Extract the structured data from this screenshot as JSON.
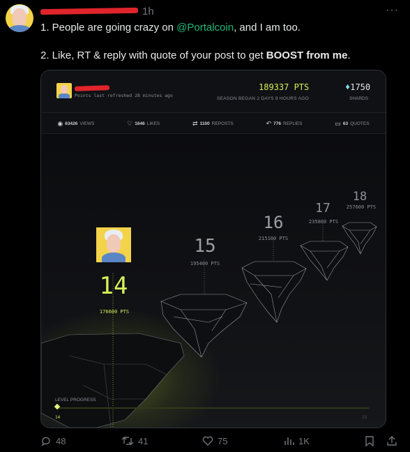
{
  "tweet": {
    "time": "1h",
    "more": "···",
    "line1_pre": "1. People are going crazy on ",
    "mention": "@Portalcoin",
    "line1_post": ", and I am too.",
    "line2_pre": "2. Like, RT & reply with quote of your post to get ",
    "line2_bold": "BOOST from me",
    "line2_post": "."
  },
  "card": {
    "refreshed": "Points last refreshed 28 minutes ago",
    "points": "189337 PTS",
    "season": "SEASON BEGAN 2 DAYS 9 HOURS AGO",
    "shards_icon": "♦",
    "shards_value": "1750",
    "shards_label": "SHARDS",
    "stats": [
      {
        "icon": "eye-icon",
        "glyph": "◉",
        "value": "63426",
        "label": "VIEWS"
      },
      {
        "icon": "heart-icon",
        "glyph": "♡",
        "value": "1646",
        "label": "LIKES"
      },
      {
        "icon": "repost-icon",
        "glyph": "⇄",
        "value": "1100",
        "label": "REPOSTS"
      },
      {
        "icon": "reply-icon",
        "glyph": "↶",
        "value": "776",
        "label": "REPLIES"
      },
      {
        "icon": "quote-icon",
        "glyph": "▭",
        "value": "63",
        "label": "QUOTES"
      }
    ],
    "current": {
      "level": "14",
      "points": "176600 PTS"
    },
    "levels": [
      {
        "level": "15",
        "points": "195400 PTS"
      },
      {
        "level": "16",
        "points": "215100 PTS"
      },
      {
        "level": "17",
        "points": "235800 PTS"
      },
      {
        "level": "18",
        "points": "257600 PTS"
      }
    ],
    "progress": {
      "label": "LEVEL PROGRESS",
      "start": "14",
      "end": "15",
      "fraction": 0.0
    }
  },
  "actions": {
    "replies": "48",
    "reposts": "41",
    "likes": "75",
    "views": "1K"
  },
  "colors": {
    "accent": "#d8ef5a",
    "mention": "#1fb97a"
  }
}
